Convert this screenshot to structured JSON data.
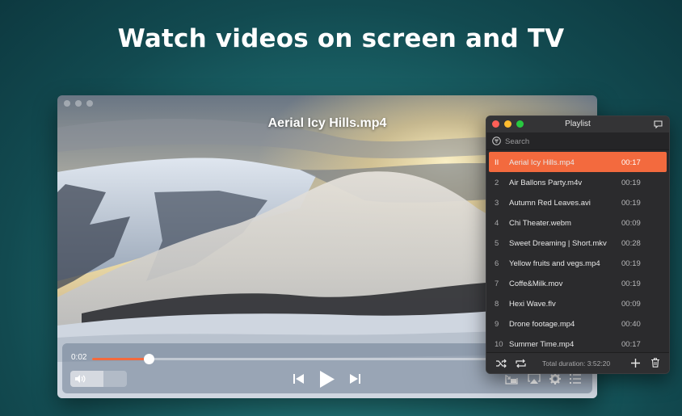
{
  "headline": "Watch videos on screen and TV",
  "player": {
    "video_title": "Aerial Icy Hills.mp4",
    "current_time": "0:02",
    "progress_fraction": 0.14,
    "volume_fraction": 0.58,
    "icons": {
      "volume": "speaker-icon",
      "prev": "skip-previous-icon",
      "play": "play-icon",
      "next": "skip-next-icon",
      "pip": "picture-in-picture-icon",
      "airplay": "airplay-icon",
      "settings": "gear-icon",
      "playlist": "list-icon"
    }
  },
  "playlist": {
    "title": "Playlist",
    "search_placeholder": "Search",
    "active_indicator": "II",
    "items": [
      {
        "num": "1",
        "name": "Aerial Icy Hills.mp4",
        "duration": "00:17",
        "active": true
      },
      {
        "num": "2",
        "name": "Air Ballons Party.m4v",
        "duration": "00:19"
      },
      {
        "num": "3",
        "name": "Autumn Red Leaves.avi",
        "duration": "00:19"
      },
      {
        "num": "4",
        "name": "Chi Theater.webm",
        "duration": "00:09"
      },
      {
        "num": "5",
        "name": "Sweet Dreaming | Short.mkv",
        "duration": "00:28"
      },
      {
        "num": "6",
        "name": "Yellow fruits and vegs.mp4",
        "duration": "00:19"
      },
      {
        "num": "7",
        "name": "Coffe&Milk.mov",
        "duration": "00:19"
      },
      {
        "num": "8",
        "name": "Hexi Wave.flv",
        "duration": "00:09"
      },
      {
        "num": "9",
        "name": "Drone footage.mp4",
        "duration": "00:40"
      },
      {
        "num": "10",
        "name": "Summer Time.mp4",
        "duration": "00:17"
      }
    ],
    "total_duration": "Total duration: 3:52:20",
    "colors": {
      "accent": "#f36a3e",
      "close": "#ff5f57",
      "minimize": "#febc2e",
      "zoom": "#28c840"
    }
  }
}
